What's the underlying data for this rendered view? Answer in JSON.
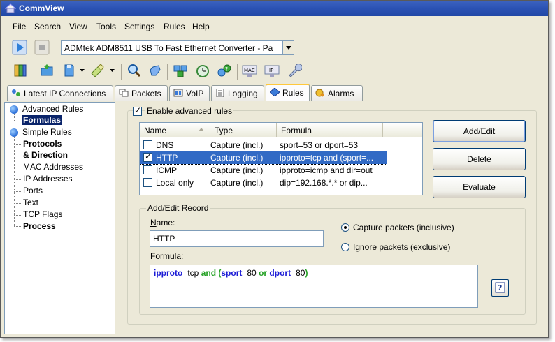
{
  "window": {
    "title": "CommView"
  },
  "menu": [
    "File",
    "Search",
    "View",
    "Tools",
    "Settings",
    "Rules",
    "Help"
  ],
  "toolbar": {
    "adapter_value": "ADMtek ADM8511 USB To Fast Ethernet Converter - Pa",
    "icons": [
      "start-capture-icon",
      "stop-capture-icon",
      "dropdown-icon"
    ],
    "icons2": [
      "book-icon",
      "open-folder-icon",
      "save-icon",
      "clear-icon",
      "search-icon",
      "hand-icon",
      "packet-generator-icon",
      "scheduler-icon",
      "statistics-icon",
      "mac-alias-icon",
      "ip-alias-icon",
      "options-wrench-icon"
    ],
    "mac_label": "MAC",
    "ip_label": "IP"
  },
  "tabs": [
    {
      "label": "Latest IP Connections",
      "icon": "connections-icon"
    },
    {
      "label": "Packets",
      "icon": "packets-icon"
    },
    {
      "label": "VoIP",
      "icon": "voip-icon"
    },
    {
      "label": "Logging",
      "icon": "logging-icon"
    },
    {
      "label": "Rules",
      "icon": "rules-icon",
      "active": true
    },
    {
      "label": "Alarms",
      "icon": "alarms-icon"
    }
  ],
  "tree": [
    {
      "label": "Advanced Rules",
      "bold": false
    },
    {
      "label": "Formulas",
      "bold": true,
      "selected": true
    },
    {
      "label": "Simple Rules",
      "bold": false
    },
    {
      "label": "Protocols",
      "bold": true
    },
    {
      "label": "& Direction",
      "bold": true
    },
    {
      "label": "MAC Addresses",
      "bold": false
    },
    {
      "label": "IP Addresses",
      "bold": false
    },
    {
      "label": "Ports",
      "bold": false
    },
    {
      "label": "Text",
      "bold": false
    },
    {
      "label": "TCP Flags",
      "bold": false
    },
    {
      "label": "Process",
      "bold": true
    }
  ],
  "rules": {
    "enable_label": "Enable advanced rules",
    "enabled": true,
    "columns": [
      "Name",
      "Type",
      "Formula"
    ],
    "rows": [
      {
        "checked": false,
        "name": "DNS",
        "type": "Capture (incl.)",
        "formula": "sport=53 or dport=53"
      },
      {
        "checked": true,
        "name": "HTTP",
        "type": "Capture (incl.)",
        "formula": "ipproto=tcp and (sport=...",
        "selected": true
      },
      {
        "checked": false,
        "name": "ICMP",
        "type": "Capture (incl.)",
        "formula": "ipproto=icmp and dir=out"
      },
      {
        "checked": false,
        "name": "Local only",
        "type": "Capture (incl.)",
        "formula": "dip=192.168.*.* or dip..."
      }
    ],
    "buttons": {
      "add_edit": "Add/Edit",
      "delete": "Delete",
      "evaluate": "Evaluate"
    }
  },
  "record": {
    "group_title": "Add/Edit Record",
    "name_label": "Name:",
    "name_value": "HTTP",
    "formula_label": "Formula:",
    "capture_label": "Capture packets (inclusive)",
    "ignore_label": "Ignore packets (exclusive)",
    "capture_selected": true,
    "formula_tokens": [
      {
        "t": "ipproto",
        "c": "kw"
      },
      {
        "t": "=tcp ",
        "c": ""
      },
      {
        "t": "and",
        "c": "op"
      },
      {
        "t": " (",
        "c": "op"
      },
      {
        "t": "sport",
        "c": "kw"
      },
      {
        "t": "=80 ",
        "c": ""
      },
      {
        "t": "or",
        "c": "op"
      },
      {
        "t": " ",
        "c": ""
      },
      {
        "t": "dport",
        "c": "kw"
      },
      {
        "t": "=80",
        "c": ""
      },
      {
        "t": ")",
        "c": "op"
      }
    ],
    "help_glyph": "?"
  },
  "colors": {
    "title_bar": "#2b52b4",
    "selection": "#0a246a",
    "row_selection": "#316ac5",
    "keyword": "#1b1bd6",
    "operator": "#22a022"
  }
}
